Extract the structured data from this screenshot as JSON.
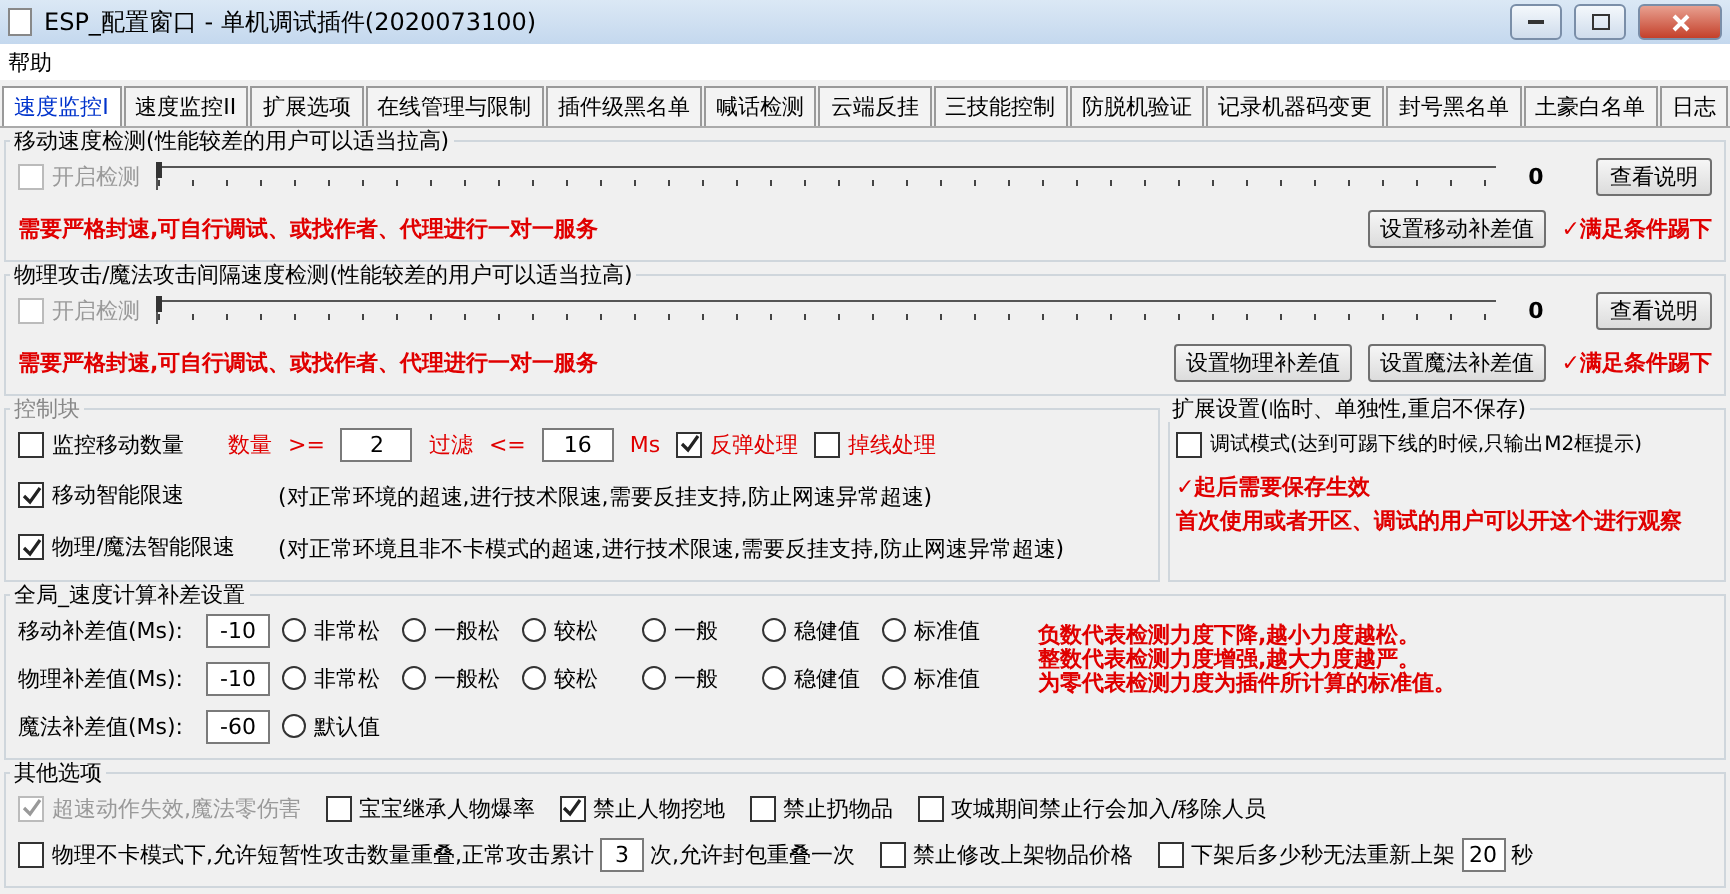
{
  "window": {
    "title": "ESP_配置窗口 - 单机调试插件(2020073100)"
  },
  "menu": [
    "帮助"
  ],
  "tabs": [
    {
      "label": "速度监控I",
      "selected": true
    },
    {
      "label": "速度监控II",
      "selected": false
    },
    {
      "label": "扩展选项",
      "selected": false
    },
    {
      "label": "在线管理与限制",
      "selected": false
    },
    {
      "label": "插件级黑名单",
      "selected": false
    },
    {
      "label": "喊话检测",
      "selected": false
    },
    {
      "label": "云端反挂",
      "selected": false
    },
    {
      "label": "三技能控制",
      "selected": false
    },
    {
      "label": "防脱机验证",
      "selected": false
    },
    {
      "label": "记录机器码变更",
      "selected": false
    },
    {
      "label": "封号黑名单",
      "selected": false
    },
    {
      "label": "土豪白名单",
      "selected": false
    },
    {
      "label": "日志",
      "selected": false
    }
  ],
  "speed_groups": [
    {
      "title": "移动速度检测(性能较差的用户可以适当拉高)",
      "enable": {
        "label": "开启检测",
        "checked": false,
        "disabled": true
      },
      "slider": {
        "level": 0,
        "reading": "0"
      },
      "help_button": "查看说明",
      "warning": "需要严格封速,可自行调试、或找作者、代理进行一对一服务",
      "buttons": [
        "设置移动补差值"
      ],
      "note": "✓满足条件踢下"
    },
    {
      "title": "物理攻击/魔法攻击间隔速度检测(性能较差的用户可以适当拉高)",
      "enable": {
        "label": "开启检测",
        "checked": false,
        "disabled": true
      },
      "slider": {
        "level": 0,
        "reading": "0"
      },
      "help_button": "查看说明",
      "warning": "需要严格封速,可自行调试、或找作者、代理进行一对一服务",
      "buttons": [
        "设置物理补差值",
        "设置魔法补差值"
      ],
      "note": "✓满足条件踢下"
    }
  ],
  "control_block": {
    "title": "控制块",
    "monitor": {
      "label": "监控移动数量",
      "checked": false
    },
    "count_label": "数量",
    "gte": ">=",
    "count": "2",
    "filter_label": "过滤",
    "lte": "<=",
    "ms": "16",
    "unit": "Ms",
    "options": [
      {
        "label": "反弹处理",
        "checked": true
      },
      {
        "label": "掉线处理",
        "checked": false
      }
    ],
    "limits": [
      {
        "label": "移动智能限速",
        "checked": true,
        "note": "(对正常环境的超速,进行技术限速,需要反挂支持,防止网速异常超速)"
      },
      {
        "label": "物理/魔法智能限速",
        "checked": true,
        "note": "(对正常环境且非不卡模式的超速,进行技术限速,需要反挂支持,防止网速异常超速)"
      }
    ]
  },
  "extension": {
    "title": "扩展设置(临时、单独性,重启不保存)",
    "debug": {
      "label": "调试模式(达到可踢下线的时候,只输出M2框提示)",
      "checked": false
    },
    "notes": [
      "✓起后需要保存生效",
      "首次使用或者开区、调试的用户可以开这个进行观察"
    ]
  },
  "compensation": {
    "title": "全局_速度计算补差设置",
    "rows": [
      {
        "label": "移动补差值(Ms):",
        "value": "-10",
        "options": [
          {
            "label": "非常松",
            "selected": false
          },
          {
            "label": "一般松",
            "selected": false
          },
          {
            "label": "较松",
            "selected": false
          },
          {
            "label": "一般",
            "selected": false
          },
          {
            "label": "稳健值",
            "selected": false
          },
          {
            "label": "标准值",
            "selected": false
          }
        ]
      },
      {
        "label": "物理补差值(Ms):",
        "value": "-10",
        "options": [
          {
            "label": "非常松",
            "selected": false
          },
          {
            "label": "一般松",
            "selected": false
          },
          {
            "label": "较松",
            "selected": false
          },
          {
            "label": "一般",
            "selected": false
          },
          {
            "label": "稳健值",
            "selected": false
          },
          {
            "label": "标准值",
            "selected": false
          }
        ]
      },
      {
        "label": "魔法补差值(Ms):",
        "value": "-60",
        "options": [
          {
            "label": "默认值",
            "selected": false
          }
        ]
      }
    ],
    "notes": [
      "负数代表检测力度下降,越小力度越松。",
      "整数代表检测力度增强,越大力度越严。",
      "为零代表检测力度为插件所计算的标准值。"
    ]
  },
  "other": {
    "title": "其他选项",
    "lines": [
      {
        "items": [
          {
            "kind": "check",
            "label": "超速动作失效,魔法零伤害",
            "checked": true,
            "disabled": true
          },
          {
            "kind": "check",
            "label": "宝宝继承人物爆率",
            "checked": false
          },
          {
            "kind": "check",
            "label": "禁止人物挖地",
            "checked": true
          },
          {
            "kind": "check",
            "label": "禁止扔物品",
            "checked": false
          },
          {
            "kind": "check",
            "label": "攻城期间禁止行会加入/移除人员",
            "checked": false
          }
        ]
      },
      {
        "items": [
          {
            "kind": "input",
            "label": "物理不卡模式下,允许短暂性攻击数量重叠,正常攻击累计",
            "checked": false,
            "value": "3",
            "suffix": "次,允许封包重叠一次"
          },
          {
            "kind": "check",
            "label": "禁止修改上架物品价格",
            "checked": false
          },
          {
            "kind": "input",
            "label": "下架后多少秒无法重新上架",
            "checked": false,
            "value": "20",
            "suffix": "秒"
          }
        ]
      }
    ]
  }
}
